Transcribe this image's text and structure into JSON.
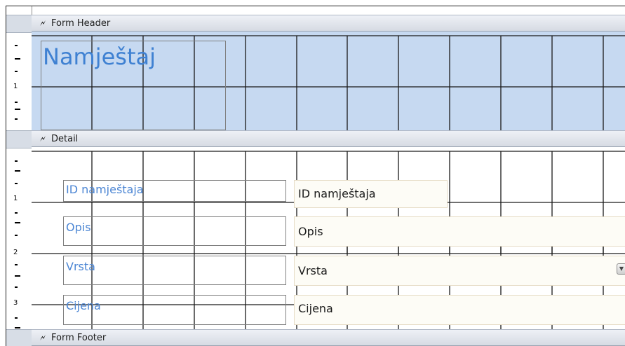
{
  "sections": {
    "form_header": {
      "label": "Form Header",
      "icon": "section-collapse-icon"
    },
    "detail": {
      "label": "Detail",
      "icon": "section-collapse-icon"
    },
    "form_footer": {
      "label": "Form Footer",
      "icon": "section-collapse-icon"
    }
  },
  "header": {
    "title": "Namještaj"
  },
  "ruler": {
    "numbers": [
      "1",
      "1",
      "2",
      "3"
    ]
  },
  "fields": [
    {
      "label": "ID namještaja",
      "control": "ID namještaja",
      "type": "textbox"
    },
    {
      "label": "Opis",
      "control": "Opis",
      "type": "textbox"
    },
    {
      "label": "Vrsta",
      "control": "Vrsta",
      "type": "combobox"
    },
    {
      "label": "Cijena",
      "control": "Cijena",
      "type": "textbox"
    }
  ],
  "colors": {
    "header_bg": "#c6d9f1",
    "label_text": "#4c86d4",
    "title_text": "#3f81d2",
    "textbox_border": "#e6dcc6"
  }
}
